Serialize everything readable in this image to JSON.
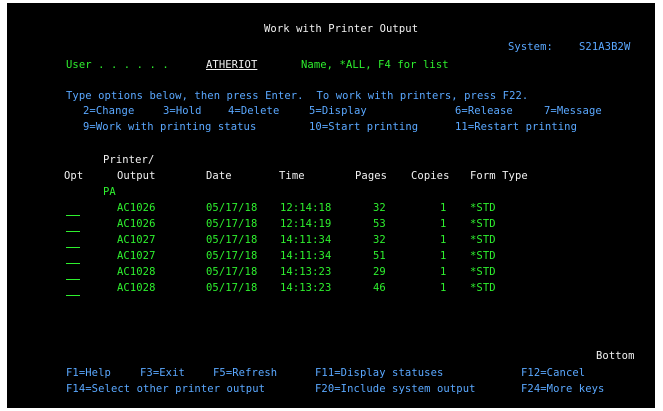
{
  "header": {
    "title": "Work with Printer Output",
    "system_label": "System:",
    "system_value": "S21A3B2W"
  },
  "user_field": {
    "label": "User . . . . . .",
    "value": "ATHERIOT",
    "hint": "Name, *ALL, F4 for list"
  },
  "instructions": {
    "line1": "Type options below, then press Enter.  To work with printers, press F22.",
    "options": [
      {
        "label": "2=Change"
      },
      {
        "label": "3=Hold"
      },
      {
        "label": "4=Delete"
      },
      {
        "label": "5=Display"
      },
      {
        "label": "6=Release"
      },
      {
        "label": "7=Message"
      },
      {
        "label": "9=Work with printing status"
      },
      {
        "label": "10=Start printing"
      },
      {
        "label": "11=Restart printing"
      }
    ]
  },
  "table": {
    "header_printer": "Printer/",
    "columns": {
      "opt": "Opt",
      "output": "Output",
      "date": "Date",
      "time": "Time",
      "pages": "Pages",
      "copies": "Copies",
      "form_type": "Form Type"
    },
    "printer_name": "PA",
    "rows": [
      {
        "output": "AC1026",
        "date": "05/17/18",
        "time": "12:14:18",
        "pages": "32",
        "copies": "1",
        "form_type": "*STD"
      },
      {
        "output": "AC1026",
        "date": "05/17/18",
        "time": "12:14:19",
        "pages": "53",
        "copies": "1",
        "form_type": "*STD"
      },
      {
        "output": "AC1027",
        "date": "05/17/18",
        "time": "14:11:34",
        "pages": "32",
        "copies": "1",
        "form_type": "*STD"
      },
      {
        "output": "AC1027",
        "date": "05/17/18",
        "time": "14:11:34",
        "pages": "51",
        "copies": "1",
        "form_type": "*STD"
      },
      {
        "output": "AC1028",
        "date": "05/17/18",
        "time": "14:13:23",
        "pages": "29",
        "copies": "1",
        "form_type": "*STD"
      },
      {
        "output": "AC1028",
        "date": "05/17/18",
        "time": "14:13:23",
        "pages": "46",
        "copies": "1",
        "form_type": "*STD"
      }
    ],
    "bottom_label": "Bottom"
  },
  "function_keys": [
    {
      "label": "F1=Help"
    },
    {
      "label": "F3=Exit"
    },
    {
      "label": "F5=Refresh"
    },
    {
      "label": "F11=Display statuses"
    },
    {
      "label": "F12=Cancel"
    },
    {
      "label": "F14=Select other printer output"
    },
    {
      "label": "F20=Include system output"
    },
    {
      "label": "F24=More keys"
    }
  ],
  "colors": {
    "background": "#000000",
    "text_white": "#f2f2f2",
    "text_green": "#2ef02e",
    "text_blue": "#5aa8ff"
  }
}
